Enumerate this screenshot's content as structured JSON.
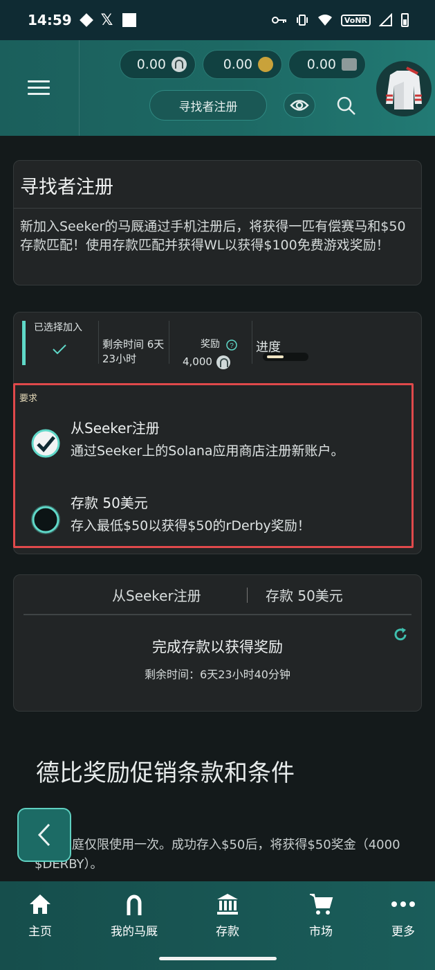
{
  "status_bar": {
    "time": "14:59",
    "network_badge": "VoNR"
  },
  "header": {
    "balances": [
      {
        "value": "0.00",
        "icon": "horseshoe-coin-icon"
      },
      {
        "value": "0.00",
        "icon": "gold-crown-coin-icon"
      },
      {
        "value": "0.00",
        "icon": "cash-icon"
      }
    ],
    "register_button": "寻找者注册"
  },
  "promo": {
    "title": "寻找者注册",
    "description": "新加入Seeker的马厩通过手机注册后，将获得一匹有偿赛马和$50存款匹配！使用存款匹配并获得WL以获得$100免费游戏奖励！"
  },
  "info": {
    "joined_label": "已选择加入",
    "time_left_label": "剩余时间 6天23小时",
    "reward_label": "奖励",
    "reward_value": "4,000",
    "progress_label": "进度",
    "progress_fraction": 0.4
  },
  "requirements": {
    "label": "要求",
    "items": [
      {
        "title": "从Seeker注册",
        "desc": "通过Seeker上的Solana应用商店注册新账户。",
        "done": true
      },
      {
        "title": "存款 50美元",
        "desc": "存入最低$50以获得$50的rDerby奖励！",
        "done": false
      }
    ]
  },
  "steps": {
    "tabs": [
      "从Seeker注册",
      "存款 50美元"
    ],
    "status": "完成存款以获得奖励",
    "remaining": "剩余时间：6天23小时40分钟"
  },
  "terms": {
    "title": "德比奖励促销条款和条件",
    "text": "每个家庭仅限使用一次。成功存入$50后，将获得$50奖金（4000 $DERBY）。"
  },
  "bottom_nav": [
    {
      "label": "主页",
      "icon": "home-icon"
    },
    {
      "label": "我的马厩",
      "icon": "horseshoe-icon"
    },
    {
      "label": "存款",
      "icon": "bank-icon"
    },
    {
      "label": "市场",
      "icon": "cart-icon"
    },
    {
      "label": "更多",
      "icon": "more-dots-icon"
    }
  ],
  "colors": {
    "accent": "#5fd8c8",
    "header": "#1d6964",
    "highlight_border": "#e0494b"
  }
}
